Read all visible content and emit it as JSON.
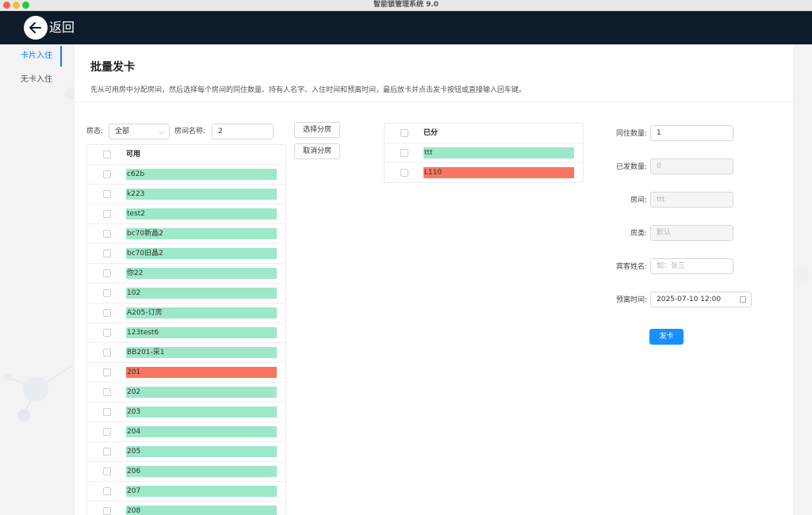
{
  "window": {
    "title": "智能锁管理系统 9.0"
  },
  "header": {
    "back_label": "返回"
  },
  "sidebar": {
    "items": [
      {
        "label": "卡片入住",
        "active": true
      },
      {
        "label": "无卡入住",
        "active": false
      }
    ]
  },
  "page": {
    "title": "批量发卡",
    "description": "先从可用房中分配房间，然后选择每个房间的同住数量、持有人名字、入住时间和预离时间，最后放卡并点击发卡按钮或直接输入回车键。"
  },
  "filters": {
    "status_label": "房态:",
    "status_value": "全部",
    "room_name_label": "房间名称:",
    "room_name_value": "2"
  },
  "actions": {
    "select_label": "选择分房",
    "cancel_label": "取消分房"
  },
  "available": {
    "header": "可用",
    "items": [
      {
        "name": "c62b",
        "status": "green"
      },
      {
        "name": "k223",
        "status": "green"
      },
      {
        "name": "test2",
        "status": "green"
      },
      {
        "name": "bc70新晶2",
        "status": "green"
      },
      {
        "name": "bc70旧晶2",
        "status": "green"
      },
      {
        "name": "你22",
        "status": "green"
      },
      {
        "name": "102",
        "status": "green"
      },
      {
        "name": "A205-订房",
        "status": "green"
      },
      {
        "name": "123test6",
        "status": "green"
      },
      {
        "name": "BB201-采1",
        "status": "green"
      },
      {
        "name": "201",
        "status": "red"
      },
      {
        "name": "202",
        "status": "green"
      },
      {
        "name": "203",
        "status": "green"
      },
      {
        "name": "204",
        "status": "green"
      },
      {
        "name": "205",
        "status": "green"
      },
      {
        "name": "206",
        "status": "green"
      },
      {
        "name": "207",
        "status": "green"
      },
      {
        "name": "208",
        "status": "green"
      }
    ]
  },
  "assigned": {
    "header": "已分",
    "items": [
      {
        "name": "ttt",
        "status": "green"
      },
      {
        "name": "L110",
        "status": "red"
      }
    ]
  },
  "form": {
    "cohabit_label": "同住数量:",
    "cohabit_value": "1",
    "issued_label": "已发数量:",
    "issued_value": "0",
    "room_label": "房间:",
    "room_value": "ttt",
    "room_type_label": "房类:",
    "room_type_value": "默认",
    "guest_name_label": "宾客姓名:",
    "guest_name_placeholder": "如：张三",
    "checkout_label": "预离时间:",
    "checkout_value": "2025-07-10 12:00",
    "submit_label": "发卡"
  },
  "colors": {
    "accent": "#1677ff",
    "header_bg": "#0d1b2a",
    "available_green": "#9de8c8",
    "occupied_red": "#f87661"
  }
}
